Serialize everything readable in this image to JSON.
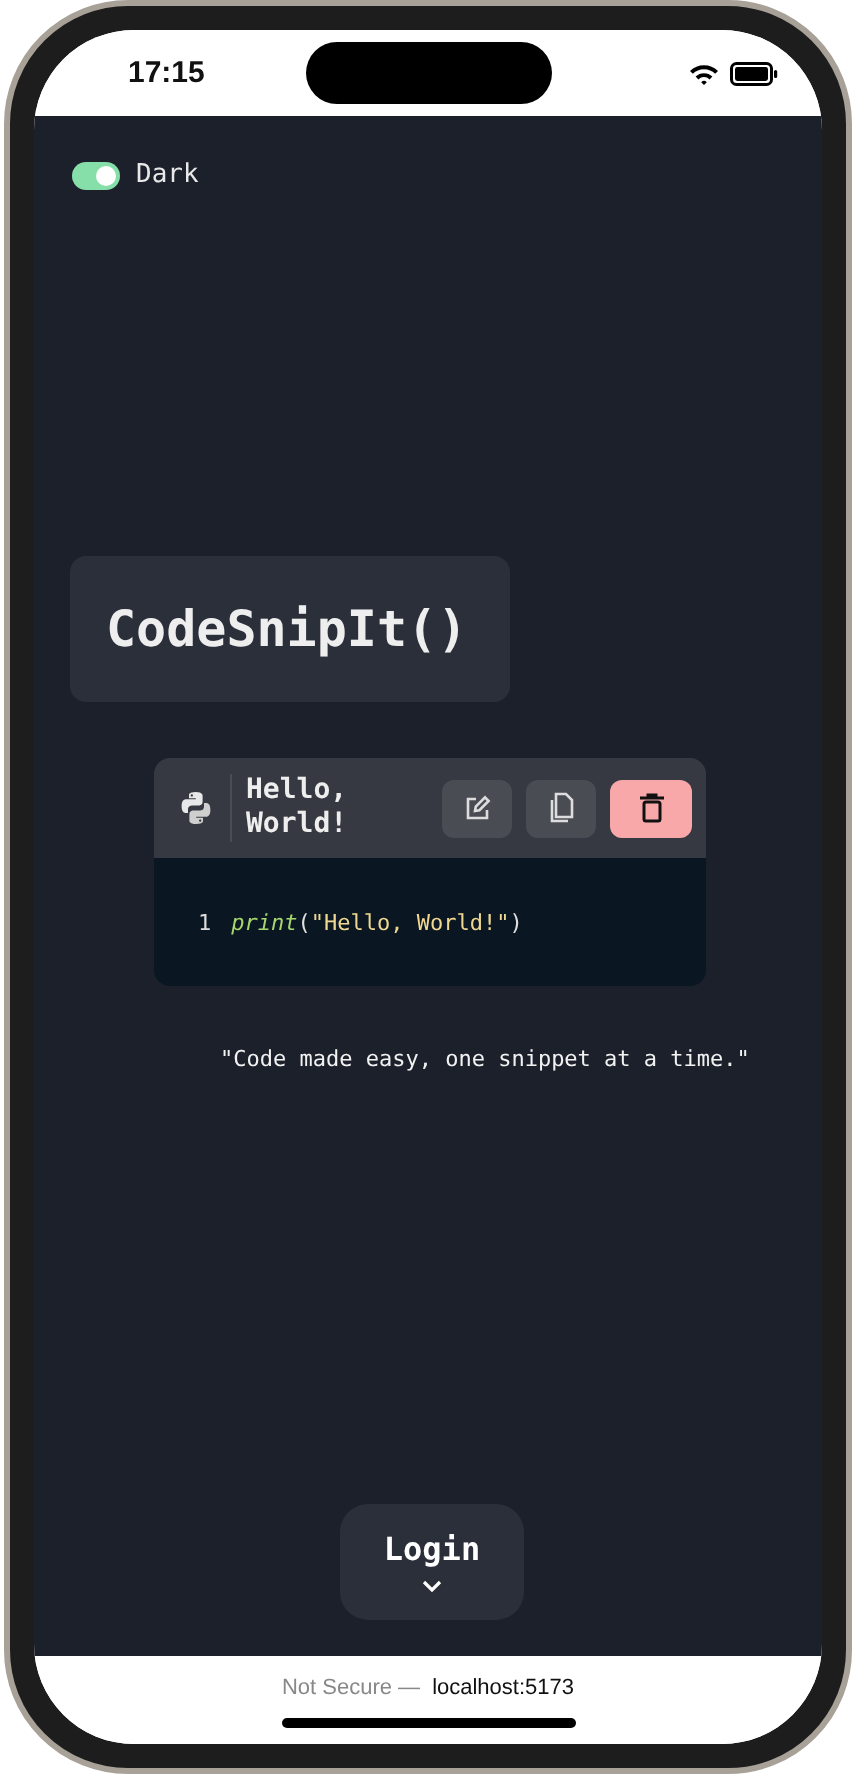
{
  "status_bar": {
    "time": "17:15"
  },
  "theme_toggle": {
    "label": "Dark",
    "on": true
  },
  "logo": "CodeSnipIt()",
  "snippet": {
    "title": "Hello, World!",
    "lines": [
      {
        "number": "1",
        "tokens": [
          {
            "text": "print",
            "kind": "function"
          },
          {
            "text": "(",
            "kind": "punct"
          },
          {
            "text": "\"Hello, World!\"",
            "kind": "string"
          },
          {
            "text": ")",
            "kind": "punct"
          }
        ]
      }
    ]
  },
  "tagline": "\"Code made easy, one snippet at a time.\"",
  "login_button": {
    "label": "Login"
  },
  "browser_bar": {
    "security": "Not Secure —",
    "url": "localhost:5173"
  }
}
